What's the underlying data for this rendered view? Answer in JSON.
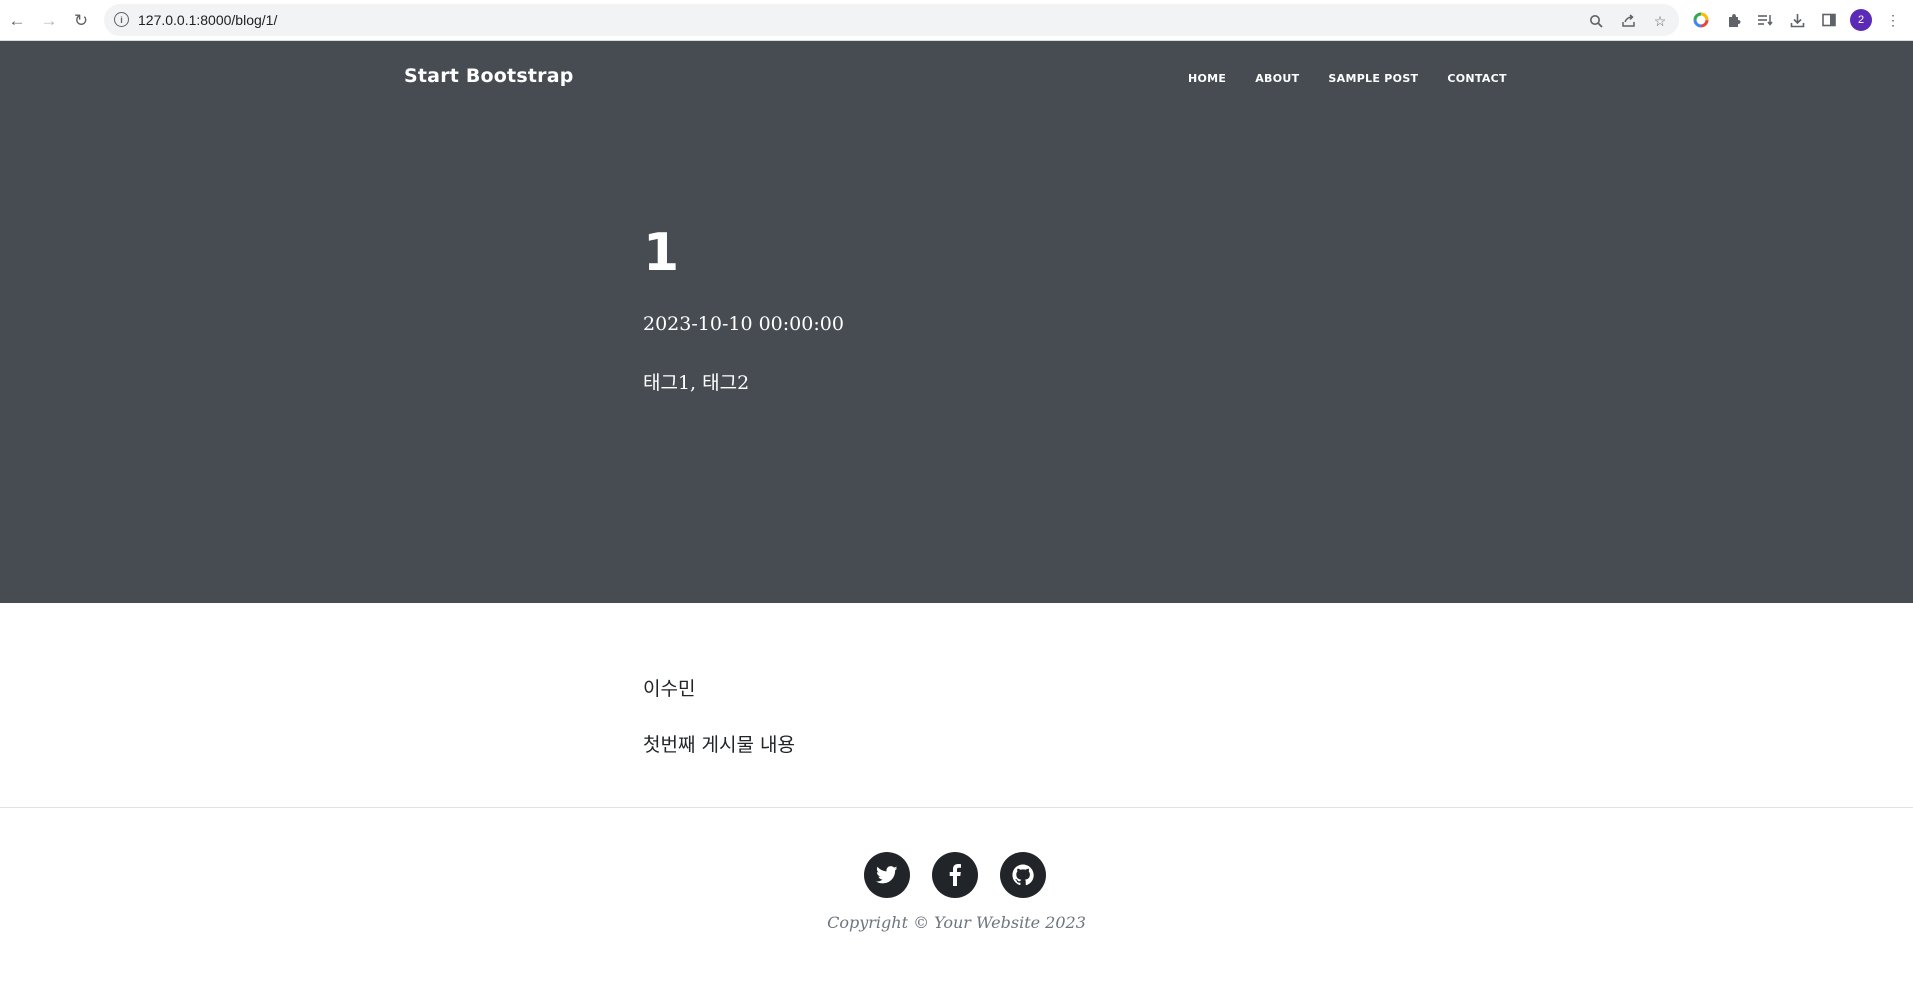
{
  "browser": {
    "url": "127.0.0.1:8000/blog/1/",
    "profile_initial": "2"
  },
  "site": {
    "brand": "Start Bootstrap",
    "nav": [
      "HOME",
      "ABOUT",
      "SAMPLE POST",
      "CONTACT"
    ]
  },
  "post": {
    "title": "1",
    "date": "2023-10-10 00:00:00",
    "tags": "태그1, 태그2",
    "author": "이수민",
    "content": "첫번째 게시물 내용"
  },
  "footer": {
    "social": [
      "twitter-icon",
      "facebook-icon",
      "github-icon"
    ],
    "copyright": "Copyright © Your Website 2023"
  },
  "colors": {
    "masthead_bg": "#474b52",
    "social_bg": "#212529",
    "profile_avatar": "#5b2bb5"
  }
}
